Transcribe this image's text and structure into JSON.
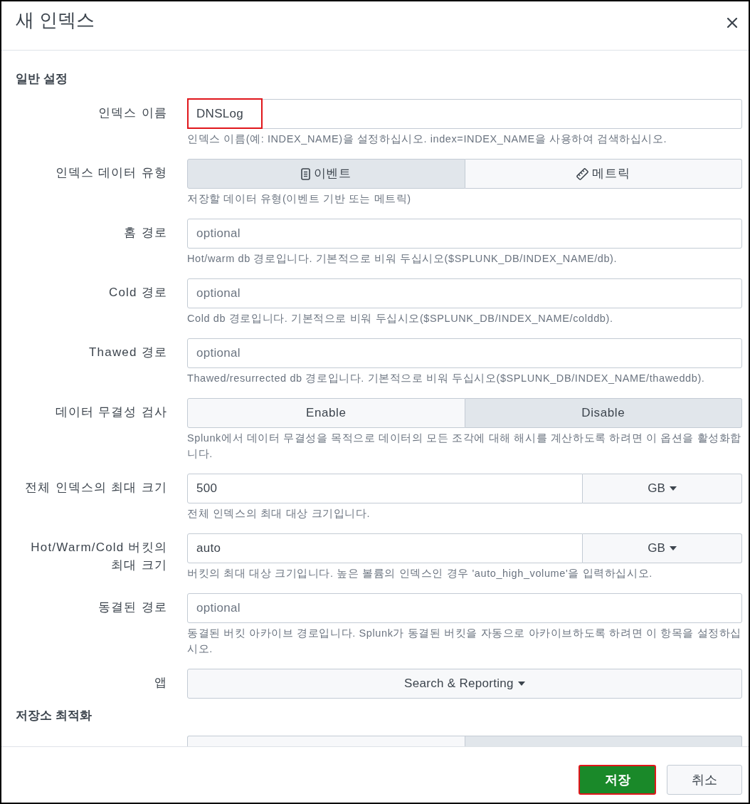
{
  "dialog": {
    "title": "새 인덱스"
  },
  "sections": [
    {
      "heading": "일반 설정",
      "rows": [
        {
          "kind": "text",
          "label": "인덱스 이름",
          "value": "DNSLog",
          "highlighted": true,
          "help": "인덱스 이름(예: INDEX_NAME)을 설정하십시오. index=INDEX_NAME을 사용하여 검색하십시오."
        },
        {
          "kind": "segmented",
          "label": "인덱스 데이터 유형",
          "options": [
            {
              "kind": "event",
              "label": "이벤트",
              "selected": true
            },
            {
              "kind": "metric",
              "label": "메트릭",
              "selected": false
            }
          ],
          "help": "저장할 데이터 유형(이벤트 기반 또는 메트릭)"
        },
        {
          "kind": "text",
          "label": "홈 경로",
          "placeholder": "optional",
          "help": "Hot/warm db 경로입니다. 기본적으로 비워 두십시오($SPLUNK_DB/INDEX_NAME/db)."
        },
        {
          "kind": "text",
          "label": "Cold 경로",
          "placeholder": "optional",
          "help": "Cold db 경로입니다. 기본적으로 비워 두십시오($SPLUNK_DB/INDEX_NAME/colddb)."
        },
        {
          "kind": "text",
          "label": "Thawed 경로",
          "placeholder": "optional",
          "help": "Thawed/resurrected db 경로입니다. 기본적으로 비워 두십시오($SPLUNK_DB/INDEX_NAME/thaweddb)."
        },
        {
          "kind": "segmented",
          "label": "데이터 무결성 검사",
          "options": [
            {
              "kind": "plain",
              "label": "Enable",
              "selected": false
            },
            {
              "kind": "plain",
              "label": "Disable",
              "selected": true
            }
          ],
          "help": "Splunk에서 데이터 무결성을 목적으로 데이터의 모든 조각에 대해 해시를 계산하도록 하려면 이 옵션을 활성화합니다."
        },
        {
          "kind": "size",
          "label": "전체 인덱스의 최대 크기",
          "value": "500",
          "unit": "GB",
          "help": "전체 인덱스의 최대 대상 크기입니다."
        },
        {
          "kind": "size",
          "label": "Hot/Warm/Cold 버킷의 최대 크기",
          "value": "auto",
          "unit": "GB",
          "help": "버킷의 최대 대상 크기입니다. 높은 볼륨의 인덱스인 경우 'auto_high_volume'을 입력하십시오."
        },
        {
          "kind": "text",
          "label": "동결된 경로",
          "placeholder": "optional",
          "help": "동결된 버킷 아카이브 경로입니다. Splunk가 동결된 버킷을 자동으로 아카이브하도록 하려면 이 항목을 설정하십시오."
        },
        {
          "kind": "select",
          "label": "앱",
          "value": "Search & Reporting"
        }
      ]
    },
    {
      "heading": "저장소 최적화",
      "rows": [
        {
          "kind": "partial",
          "options": [
            {
              "selected": false
            },
            {
              "selected": true
            }
          ]
        }
      ]
    }
  ],
  "footer": {
    "buttons": [
      {
        "kind": "primary",
        "label": "저장",
        "highlighted": true
      },
      {
        "kind": "secondary",
        "label": "취소",
        "highlighted": false
      }
    ]
  }
}
